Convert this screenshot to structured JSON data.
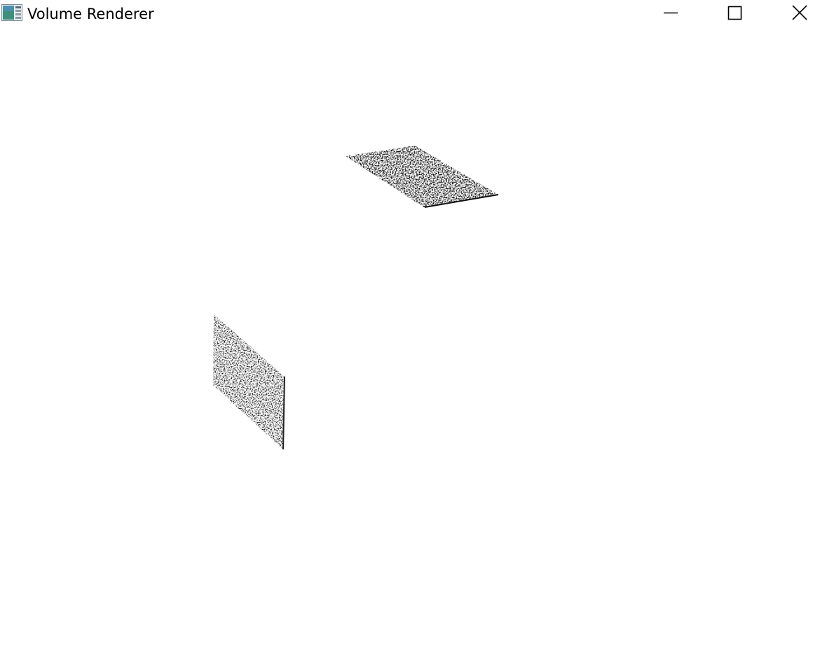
{
  "window": {
    "title": "Volume Renderer",
    "controls": {
      "minimize": "minimize",
      "maximize": "maximize",
      "close": "close"
    },
    "icons": {
      "app": "volume-renderer-app-icon",
      "minimize": "minimize-icon",
      "maximize": "maximize-icon",
      "close": "close-icon"
    }
  },
  "viewport": {
    "background": "#ffffff",
    "slices": [
      {
        "name": "horizontal-slice",
        "texture": "grayscale-noise"
      },
      {
        "name": "vertical-slice",
        "texture": "grayscale-noise"
      }
    ]
  },
  "colors": {
    "titlebar_bg": "#ffffff",
    "text": "#000000",
    "icon_teal": "#2e8b7a",
    "icon_blue": "#3a6ea5"
  }
}
